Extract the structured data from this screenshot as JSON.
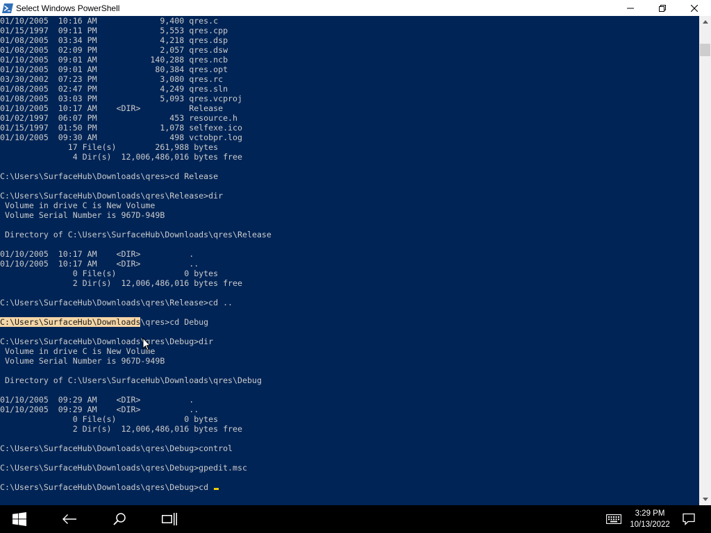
{
  "window": {
    "title": "Select Windows PowerShell",
    "icon": "powershell-icon",
    "controls": [
      "minimize-icon",
      "restore-icon",
      "close-icon"
    ]
  },
  "console": {
    "lines": [
      "01/10/2005  10:16 AM             9,400 qres.c",
      "01/15/1997  09:11 PM             5,553 qres.cpp",
      "01/08/2005  03:34 PM             4,218 qres.dsp",
      "01/08/2005  02:09 PM             2,057 qres.dsw",
      "01/10/2005  09:01 AM           140,288 qres.ncb",
      "01/10/2005  09:01 AM            80,384 qres.opt",
      "03/30/2002  07:23 PM             3,080 qres.rc",
      "01/08/2005  02:47 PM             4,249 qres.sln",
      "01/08/2005  03:03 PM             5,093 qres.vcproj",
      "01/10/2005  10:17 AM    <DIR>          Release",
      "01/02/1997  06:07 PM               453 resource.h",
      "01/15/1997  01:50 PM             1,078 selfexe.ico",
      "01/10/2005  09:30 AM               498 vctobpr.log",
      "              17 File(s)        261,988 bytes",
      "               4 Dir(s)  12,006,486,016 bytes free",
      "",
      "C:\\Users\\SurfaceHub\\Downloads\\qres>cd Release",
      "",
      "C:\\Users\\SurfaceHub\\Downloads\\qres\\Release>dir",
      " Volume in drive C is New Volume",
      " Volume Serial Number is 967D-949B",
      "",
      " Directory of C:\\Users\\SurfaceHub\\Downloads\\qres\\Release",
      "",
      "01/10/2005  10:17 AM    <DIR>          .",
      "01/10/2005  10:17 AM    <DIR>          ..",
      "               0 File(s)              0 bytes",
      "               2 Dir(s)  12,006,486,016 bytes free",
      "",
      "C:\\Users\\SurfaceHub\\Downloads\\qres\\Release>cd ..",
      "",
      "",
      "",
      "C:\\Users\\SurfaceHub\\Downloads\\qres\\Debug>dir",
      " Volume in drive C is New Volume",
      " Volume Serial Number is 967D-949B",
      "",
      " Directory of C:\\Users\\SurfaceHub\\Downloads\\qres\\Debug",
      "",
      "01/10/2005  09:29 AM    <DIR>          .",
      "01/10/2005  09:29 AM    <DIR>          ..",
      "               0 File(s)              0 bytes",
      "               2 Dir(s)  12,006,486,016 bytes free",
      "",
      "C:\\Users\\SurfaceHub\\Downloads\\qres\\Debug>control",
      "",
      "C:\\Users\\SurfaceHub\\Downloads\\qres\\Debug>gpedit.msc",
      "",
      ""
    ],
    "selection_line": {
      "selected_text": "C:\\Users\\SurfaceHub\\Downloads",
      "rest_text": "\\qres>cd Debug"
    },
    "prompt_line": {
      "text": "C:\\Users\\SurfaceHub\\Downloads\\qres\\Debug>cd "
    },
    "colors": {
      "background": "#012456",
      "text": "#cccccc",
      "selection": "#f5d6a7",
      "caret": "#f2cc00"
    }
  },
  "scrollbar": {
    "up_icon": "scroll-up-arrow-icon",
    "down_icon": "scroll-down-arrow-icon"
  },
  "taskbar": {
    "items": [
      "windows-start-icon",
      "back-arrow-icon",
      "search-icon",
      "task-view-icon",
      "touch-keyboard-icon",
      "action-center-icon"
    ],
    "time": "3:29 PM",
    "date": "10/13/2022"
  }
}
